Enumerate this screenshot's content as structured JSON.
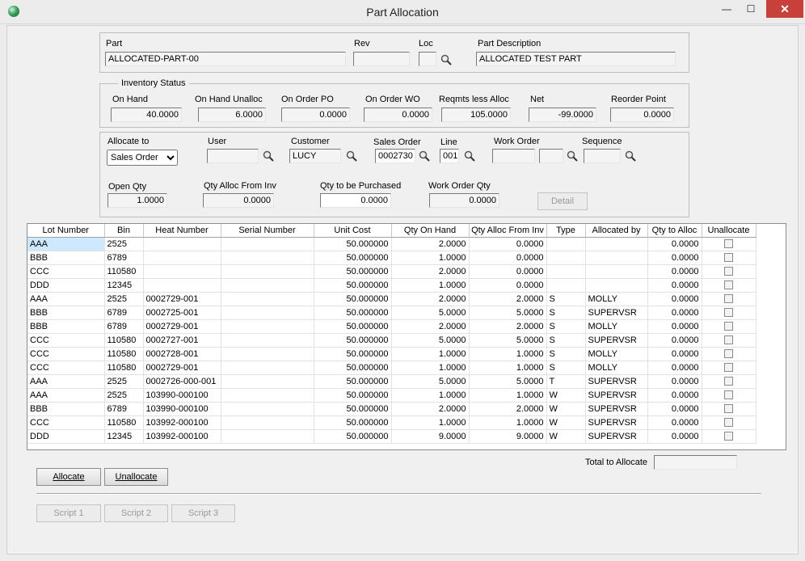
{
  "window": {
    "title": "Part Allocation",
    "minimize": "—",
    "maximize": "☐",
    "close": "✕"
  },
  "part": {
    "part_label": "Part",
    "part_value": "ALLOCATED-PART-00",
    "rev_label": "Rev",
    "rev_value": "",
    "loc_label": "Loc",
    "loc_value": "",
    "desc_label": "Part Description",
    "desc_value": "ALLOCATED TEST PART"
  },
  "inventory": {
    "legend": "Inventory Status",
    "on_hand_label": "On Hand",
    "on_hand": "40.0000",
    "on_hand_unalloc_label": "On Hand Unalloc",
    "on_hand_unalloc": "6.0000",
    "on_order_po_label": "On Order PO",
    "on_order_po": "0.0000",
    "on_order_wo_label": "On Order WO",
    "on_order_wo": "0.0000",
    "reqmts_label": "Reqmts less Alloc",
    "reqmts": "105.0000",
    "net_label": "Net",
    "net": "-99.0000",
    "reorder_label": "Reorder Point",
    "reorder": "0.0000"
  },
  "allocate": {
    "allocate_to_label": "Allocate to",
    "allocate_to_value": "Sales Order",
    "user_label": "User",
    "user_value": "",
    "customer_label": "Customer",
    "customer_value": "LUCY",
    "sales_order_label": "Sales Order",
    "sales_order_value": "0002730",
    "line_label": "Line",
    "line_value": "001",
    "work_order_label": "Work Order",
    "work_order_value": "",
    "work_order_suffix": "",
    "sequence_label": "Sequence",
    "sequence_value": "",
    "open_qty_label": "Open Qty",
    "open_qty": "1.0000",
    "qty_alloc_inv_label": "Qty Alloc From Inv",
    "qty_alloc_inv": "0.0000",
    "qty_purchased_label": "Qty to be Purchased",
    "qty_purchased": "0.0000",
    "wo_qty_label": "Work Order Qty",
    "wo_qty": "0.0000",
    "detail_button": "Detail"
  },
  "grid": {
    "columns": [
      "Lot Number",
      "Bin",
      "Heat Number",
      "Serial Number",
      "Unit Cost",
      "Qty On Hand",
      "Qty Alloc From Inv",
      "Type",
      "Allocated by",
      "Qty to Alloc",
      "Unallocate"
    ],
    "rows": [
      [
        "AAA",
        "2525",
        "",
        "",
        "50.000000",
        "2.0000",
        "0.0000",
        "",
        "",
        "0.0000"
      ],
      [
        "BBB",
        "6789",
        "",
        "",
        "50.000000",
        "1.0000",
        "0.0000",
        "",
        "",
        "0.0000"
      ],
      [
        "CCC",
        "110580",
        "",
        "",
        "50.000000",
        "2.0000",
        "0.0000",
        "",
        "",
        "0.0000"
      ],
      [
        "DDD",
        "12345",
        "",
        "",
        "50.000000",
        "1.0000",
        "0.0000",
        "",
        "",
        "0.0000"
      ],
      [
        "AAA",
        "2525",
        "0002729-001",
        "",
        "50.000000",
        "2.0000",
        "2.0000",
        "S",
        "MOLLY",
        "0.0000"
      ],
      [
        "BBB",
        "6789",
        "0002725-001",
        "",
        "50.000000",
        "5.0000",
        "5.0000",
        "S",
        "SUPERVSR",
        "0.0000"
      ],
      [
        "BBB",
        "6789",
        "0002729-001",
        "",
        "50.000000",
        "2.0000",
        "2.0000",
        "S",
        "MOLLY",
        "0.0000"
      ],
      [
        "CCC",
        "110580",
        "0002727-001",
        "",
        "50.000000",
        "5.0000",
        "5.0000",
        "S",
        "SUPERVSR",
        "0.0000"
      ],
      [
        "CCC",
        "110580",
        "0002728-001",
        "",
        "50.000000",
        "1.0000",
        "1.0000",
        "S",
        "MOLLY",
        "0.0000"
      ],
      [
        "CCC",
        "110580",
        "0002729-001",
        "",
        "50.000000",
        "1.0000",
        "1.0000",
        "S",
        "MOLLY",
        "0.0000"
      ],
      [
        "AAA",
        "2525",
        "0002726-000-001",
        "",
        "50.000000",
        "5.0000",
        "5.0000",
        "T",
        "SUPERVSR",
        "0.0000"
      ],
      [
        "AAA",
        "2525",
        "103990-000100",
        "",
        "50.000000",
        "1.0000",
        "1.0000",
        "W",
        "SUPERVSR",
        "0.0000"
      ],
      [
        "BBB",
        "6789",
        "103990-000100",
        "",
        "50.000000",
        "2.0000",
        "2.0000",
        "W",
        "SUPERVSR",
        "0.0000"
      ],
      [
        "CCC",
        "110580",
        "103992-000100",
        "",
        "50.000000",
        "1.0000",
        "1.0000",
        "W",
        "SUPERVSR",
        "0.0000"
      ],
      [
        "DDD",
        "12345",
        "103992-000100",
        "",
        "50.000000",
        "9.0000",
        "9.0000",
        "W",
        "SUPERVSR",
        "0.0000"
      ]
    ]
  },
  "footer": {
    "total_label": "Total to Allocate",
    "total_value": "",
    "allocate_button": "Allocate",
    "unallocate_button": "Unallocate",
    "script1": "Script 1",
    "script2": "Script 2",
    "script3": "Script 3"
  }
}
